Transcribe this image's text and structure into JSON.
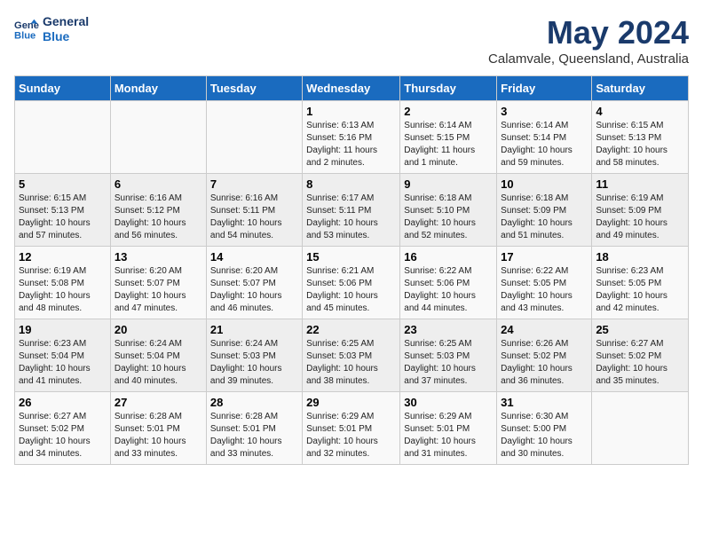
{
  "header": {
    "logo_line1": "General",
    "logo_line2": "Blue",
    "month": "May 2024",
    "location": "Calamvale, Queensland, Australia"
  },
  "weekdays": [
    "Sunday",
    "Monday",
    "Tuesday",
    "Wednesday",
    "Thursday",
    "Friday",
    "Saturday"
  ],
  "weeks": [
    [
      {
        "day": "",
        "info": ""
      },
      {
        "day": "",
        "info": ""
      },
      {
        "day": "",
        "info": ""
      },
      {
        "day": "1",
        "info": "Sunrise: 6:13 AM\nSunset: 5:16 PM\nDaylight: 11 hours\nand 2 minutes."
      },
      {
        "day": "2",
        "info": "Sunrise: 6:14 AM\nSunset: 5:15 PM\nDaylight: 11 hours\nand 1 minute."
      },
      {
        "day": "3",
        "info": "Sunrise: 6:14 AM\nSunset: 5:14 PM\nDaylight: 10 hours\nand 59 minutes."
      },
      {
        "day": "4",
        "info": "Sunrise: 6:15 AM\nSunset: 5:13 PM\nDaylight: 10 hours\nand 58 minutes."
      }
    ],
    [
      {
        "day": "5",
        "info": "Sunrise: 6:15 AM\nSunset: 5:13 PM\nDaylight: 10 hours\nand 57 minutes."
      },
      {
        "day": "6",
        "info": "Sunrise: 6:16 AM\nSunset: 5:12 PM\nDaylight: 10 hours\nand 56 minutes."
      },
      {
        "day": "7",
        "info": "Sunrise: 6:16 AM\nSunset: 5:11 PM\nDaylight: 10 hours\nand 54 minutes."
      },
      {
        "day": "8",
        "info": "Sunrise: 6:17 AM\nSunset: 5:11 PM\nDaylight: 10 hours\nand 53 minutes."
      },
      {
        "day": "9",
        "info": "Sunrise: 6:18 AM\nSunset: 5:10 PM\nDaylight: 10 hours\nand 52 minutes."
      },
      {
        "day": "10",
        "info": "Sunrise: 6:18 AM\nSunset: 5:09 PM\nDaylight: 10 hours\nand 51 minutes."
      },
      {
        "day": "11",
        "info": "Sunrise: 6:19 AM\nSunset: 5:09 PM\nDaylight: 10 hours\nand 49 minutes."
      }
    ],
    [
      {
        "day": "12",
        "info": "Sunrise: 6:19 AM\nSunset: 5:08 PM\nDaylight: 10 hours\nand 48 minutes."
      },
      {
        "day": "13",
        "info": "Sunrise: 6:20 AM\nSunset: 5:07 PM\nDaylight: 10 hours\nand 47 minutes."
      },
      {
        "day": "14",
        "info": "Sunrise: 6:20 AM\nSunset: 5:07 PM\nDaylight: 10 hours\nand 46 minutes."
      },
      {
        "day": "15",
        "info": "Sunrise: 6:21 AM\nSunset: 5:06 PM\nDaylight: 10 hours\nand 45 minutes."
      },
      {
        "day": "16",
        "info": "Sunrise: 6:22 AM\nSunset: 5:06 PM\nDaylight: 10 hours\nand 44 minutes."
      },
      {
        "day": "17",
        "info": "Sunrise: 6:22 AM\nSunset: 5:05 PM\nDaylight: 10 hours\nand 43 minutes."
      },
      {
        "day": "18",
        "info": "Sunrise: 6:23 AM\nSunset: 5:05 PM\nDaylight: 10 hours\nand 42 minutes."
      }
    ],
    [
      {
        "day": "19",
        "info": "Sunrise: 6:23 AM\nSunset: 5:04 PM\nDaylight: 10 hours\nand 41 minutes."
      },
      {
        "day": "20",
        "info": "Sunrise: 6:24 AM\nSunset: 5:04 PM\nDaylight: 10 hours\nand 40 minutes."
      },
      {
        "day": "21",
        "info": "Sunrise: 6:24 AM\nSunset: 5:03 PM\nDaylight: 10 hours\nand 39 minutes."
      },
      {
        "day": "22",
        "info": "Sunrise: 6:25 AM\nSunset: 5:03 PM\nDaylight: 10 hours\nand 38 minutes."
      },
      {
        "day": "23",
        "info": "Sunrise: 6:25 AM\nSunset: 5:03 PM\nDaylight: 10 hours\nand 37 minutes."
      },
      {
        "day": "24",
        "info": "Sunrise: 6:26 AM\nSunset: 5:02 PM\nDaylight: 10 hours\nand 36 minutes."
      },
      {
        "day": "25",
        "info": "Sunrise: 6:27 AM\nSunset: 5:02 PM\nDaylight: 10 hours\nand 35 minutes."
      }
    ],
    [
      {
        "day": "26",
        "info": "Sunrise: 6:27 AM\nSunset: 5:02 PM\nDaylight: 10 hours\nand 34 minutes."
      },
      {
        "day": "27",
        "info": "Sunrise: 6:28 AM\nSunset: 5:01 PM\nDaylight: 10 hours\nand 33 minutes."
      },
      {
        "day": "28",
        "info": "Sunrise: 6:28 AM\nSunset: 5:01 PM\nDaylight: 10 hours\nand 33 minutes."
      },
      {
        "day": "29",
        "info": "Sunrise: 6:29 AM\nSunset: 5:01 PM\nDaylight: 10 hours\nand 32 minutes."
      },
      {
        "day": "30",
        "info": "Sunrise: 6:29 AM\nSunset: 5:01 PM\nDaylight: 10 hours\nand 31 minutes."
      },
      {
        "day": "31",
        "info": "Sunrise: 6:30 AM\nSunset: 5:00 PM\nDaylight: 10 hours\nand 30 minutes."
      },
      {
        "day": "",
        "info": ""
      }
    ]
  ]
}
